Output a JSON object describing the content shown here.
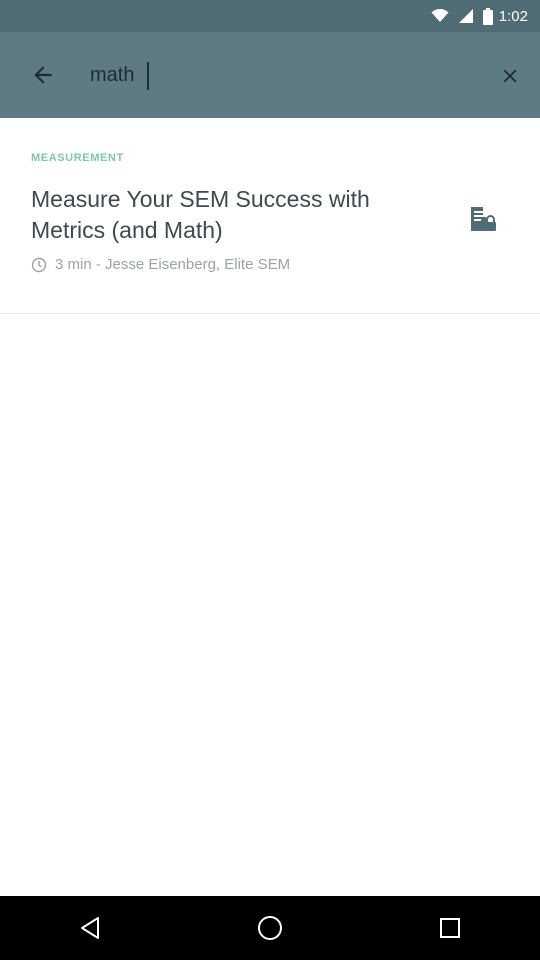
{
  "status_bar": {
    "time": "1:02"
  },
  "search": {
    "value": "math"
  },
  "result": {
    "category": "MEASUREMENT",
    "title": "Measure Your SEM Success with Metrics (and Math)",
    "meta": "3 min - Jesse Eisenberg, Elite SEM"
  },
  "colors": {
    "toolbar": "#5e7a82",
    "status_bar": "#4f6b73",
    "accent": "#7fc8a4"
  },
  "icons": [
    "back-arrow-icon",
    "close-icon",
    "clock-icon",
    "locked-article-icon",
    "nav-back-icon",
    "nav-home-icon",
    "nav-recents-icon"
  ]
}
